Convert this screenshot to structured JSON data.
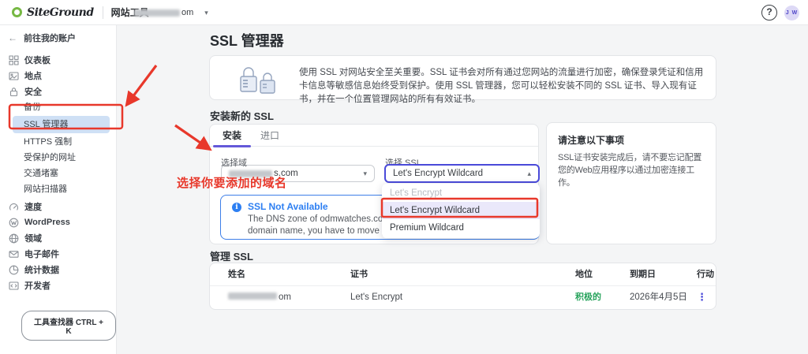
{
  "colors": {
    "brand_green": "#76b843",
    "accent_purple": "#6459d9",
    "alert_blue": "#2d7ff2",
    "status_green": "#27a35c",
    "annotation_red": "#e8382b",
    "active_item_bg": "#cfe0f5"
  },
  "topbar": {
    "logo_text": "SiteGround",
    "nav_item": "网站工具",
    "domain_suffix": "om",
    "dropdown_icon": "▾",
    "help_icon": "?",
    "avatar_initials": "J W"
  },
  "sidebar": {
    "back": {
      "icon": "←",
      "label": "前往我的账户"
    },
    "items": [
      {
        "icon": "grid-icon",
        "label": "仪表板"
      },
      {
        "icon": "site-icon",
        "label": "地点"
      },
      {
        "icon": "lock-icon",
        "label": "安全"
      },
      {
        "icon": "speed-icon",
        "label": "速度"
      },
      {
        "icon": "wordpress-icon",
        "label": "WordPress"
      },
      {
        "icon": "globe-icon",
        "label": "领域"
      },
      {
        "icon": "mail-icon",
        "label": "电子邮件"
      },
      {
        "icon": "stats-icon",
        "label": "统计数据"
      },
      {
        "icon": "dev-icon",
        "label": "开发者"
      }
    ],
    "security_subitems": [
      "备份",
      "SSL 管理器",
      "HTTPS 强制",
      "受保护的网址",
      "交通堵塞",
      "网站扫描器"
    ],
    "active_subitem": "SSL 管理器",
    "tool_finder_label": "工具查找器 CTRL + K"
  },
  "main": {
    "title": "SSL 管理器",
    "intro_text": "使用 SSL 对网站安全至关重要。SSL 证书会对所有通过您网站的流量进行加密，确保登录凭证和信用卡信息等敏感信息始终受到保护。使用 SSL 管理器，您可以轻松安装不同的 SSL 证书、导入现有证书，并在一个位置管理网站的所有有效证书。",
    "install_section": {
      "heading": "安装新的 SSL",
      "tabs": [
        {
          "label": "安装",
          "active": true
        },
        {
          "label": "进口",
          "active": false
        }
      ],
      "domain_field": {
        "label": "选择域",
        "value_suffix": "s.com",
        "caret": "▾"
      },
      "ssl_field": {
        "label": "选择 SSL",
        "value": "Let's Encrypt Wildcard",
        "caret": "▴"
      },
      "dropdown_options": [
        {
          "label": "Let's Encrypt",
          "state": "disabled"
        },
        {
          "label": "Let's Encrypt Wildcard",
          "state": "selected"
        },
        {
          "label": "Premium Wildcard",
          "state": "normal"
        }
      ],
      "alert": {
        "title": "SSL Not Available",
        "icon": "i",
        "line1": "The DNS zone of odmwatches.com is not hosted",
        "line2": "domain name, you have to move your DNS zone fi"
      },
      "note": {
        "title": "请注意以下事项",
        "body": "SSL证书安装完成后，请不要忘记配置您的Web应用程序以通过加密连接工作。"
      }
    },
    "manage_section": {
      "heading": "管理 SSL",
      "columns": [
        "姓名",
        "证书",
        "地位",
        "到期日",
        "行动"
      ],
      "row": {
        "name_suffix": "om",
        "certificate": "Let's Encrypt",
        "status": "积极的",
        "expiry": "2026年4月5日",
        "action_icon": "⋮"
      }
    }
  },
  "annotations": {
    "select_domain_note": "选择你要添加的域名"
  }
}
